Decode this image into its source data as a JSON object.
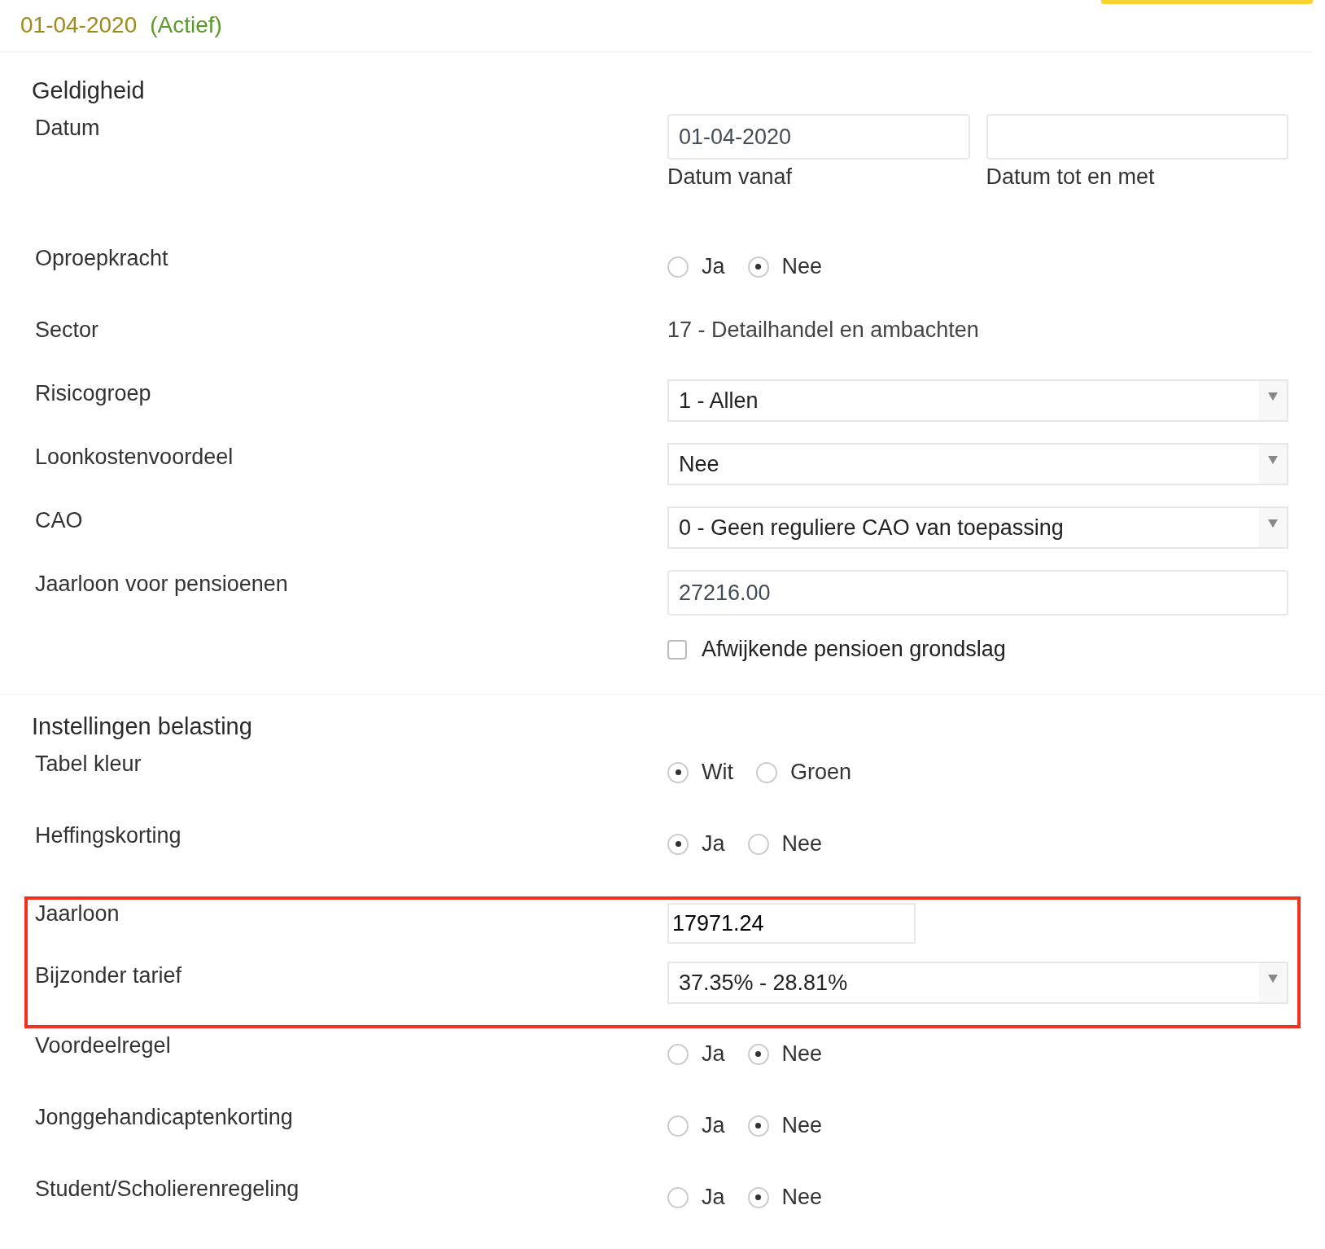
{
  "header": {
    "date": "01-04-2020",
    "status": "(Actief)"
  },
  "sections": [
    {
      "title": "Geldigheid",
      "blocks": [
        {
          "highlighted": false,
          "rows": [
            {
              "kind": "date_range",
              "label": "Datum",
              "from_value": "01-04-2020",
              "from_caption": "Datum vanaf",
              "to_caption": "Datum tot en met"
            },
            {
              "kind": "radio",
              "label": "Oproepkracht",
              "options": [
                {
                  "label": "Ja",
                  "selected": false
                },
                {
                  "label": "Nee",
                  "selected": true
                }
              ]
            },
            {
              "kind": "text",
              "label": "Sector",
              "value": "17 - Detailhandel en ambachten"
            },
            {
              "kind": "select",
              "label": "Risicogroep",
              "value": "1 - Allen"
            },
            {
              "kind": "select",
              "label": "Loonkostenvoordeel",
              "value": "Nee"
            },
            {
              "kind": "select",
              "label": "CAO",
              "value": "0 - Geen reguliere CAO van toepassing"
            },
            {
              "kind": "input",
              "label": "Jaarloon voor pensioenen",
              "value": "27216.00"
            },
            {
              "kind": "checkbox",
              "text": "Afwijkende pensioen grondslag",
              "checked": false
            }
          ]
        }
      ]
    },
    {
      "title": "Instellingen belasting",
      "blocks": [
        {
          "highlighted": false,
          "rows": [
            {
              "kind": "radio",
              "label": "Tabel kleur",
              "options": [
                {
                  "label": "Wit",
                  "selected": true
                },
                {
                  "label": "Groen",
                  "selected": false
                }
              ]
            },
            {
              "kind": "radio",
              "label": "Heffingskorting",
              "options": [
                {
                  "label": "Ja",
                  "selected": true
                },
                {
                  "label": "Nee",
                  "selected": false
                }
              ]
            }
          ]
        },
        {
          "highlighted": true,
          "rows": [
            {
              "kind": "input_short",
              "label": "Jaarloon",
              "value": "17971.24"
            },
            {
              "kind": "select",
              "label": "Bijzonder tarief",
              "value": "37.35% - 28.81%"
            }
          ]
        },
        {
          "highlighted": false,
          "rows": [
            {
              "kind": "radio",
              "label": "Voordeelregel",
              "options": [
                {
                  "label": "Ja",
                  "selected": false
                },
                {
                  "label": "Nee",
                  "selected": true
                }
              ]
            },
            {
              "kind": "radio",
              "label": "Jonggehandicaptenkorting",
              "options": [
                {
                  "label": "Ja",
                  "selected": false
                },
                {
                  "label": "Nee",
                  "selected": true
                }
              ]
            },
            {
              "kind": "radio",
              "label": "Student/Scholierenregeling",
              "options": [
                {
                  "label": "Ja",
                  "selected": false
                },
                {
                  "label": "Nee",
                  "selected": true
                }
              ]
            }
          ]
        }
      ]
    }
  ]
}
